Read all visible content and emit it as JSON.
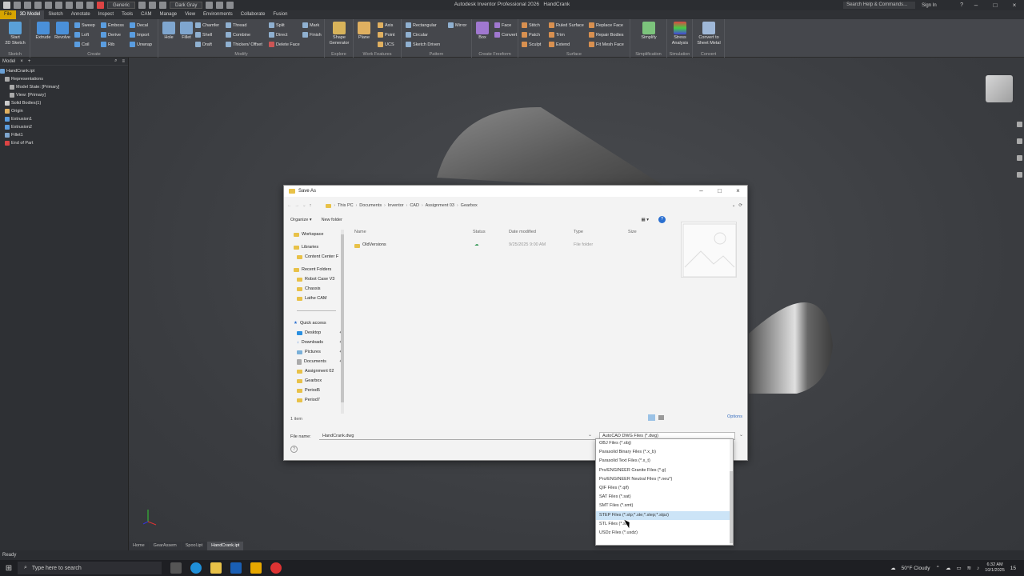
{
  "titlebar": {
    "app_title": "Autodesk Inventor Professional 2026",
    "doc_title": "HandCrank",
    "appearance": "Generic",
    "theme": "Dark Gray",
    "help_search_placeholder": "Search Help & Commands...",
    "signin": "Sign In"
  },
  "tabs": [
    "File",
    "3D Model",
    "Sketch",
    "Annotate",
    "Inspect",
    "Tools",
    "CAM",
    "Manage",
    "View",
    "Environments",
    "Collaborate",
    "Fusion"
  ],
  "ribbon": {
    "sketch": {
      "title": "Sketch",
      "start": "Start\n2D Sketch"
    },
    "create": {
      "title": "Create",
      "items": [
        "Extrude",
        "Revolve",
        "Sweep",
        "Loft",
        "Coil",
        "Emboss",
        "Derive",
        "Rib",
        "Decal",
        "Import",
        "Unwrap"
      ]
    },
    "modify": {
      "title": "Modify",
      "items": [
        "Hole",
        "Fillet",
        "Chamfer",
        "Shell",
        "Draft",
        "Thread",
        "Combine",
        "Thicken/ Offset",
        "Split",
        "Direct",
        "Delete Face"
      ]
    },
    "explore": {
      "title": "Explore",
      "item": "Shape\nGenerator"
    },
    "work": {
      "title": "Work Features",
      "plane": "Plane",
      "items": [
        "Axis",
        "Point",
        "UCS"
      ]
    },
    "pattern": {
      "title": "Pattern",
      "items": [
        "Rectangular",
        "Circular",
        "Sketch Driven",
        "Mirror"
      ]
    },
    "freeform": {
      "title": "Create Freeform",
      "box": "Box",
      "items": [
        "Face",
        "Convert"
      ]
    },
    "surface": {
      "title": "Surface",
      "items": [
        "Stitch",
        "Patch",
        "Sculpt",
        "Ruled Surface",
        "Trim",
        "Extend",
        "Replace Face",
        "Repair Bodies",
        "Fit Mesh Face"
      ]
    },
    "mark": {
      "items": [
        "Mark",
        "Finish"
      ]
    },
    "simplification": {
      "title": "Simplification",
      "item": "Simplify"
    },
    "simulation": {
      "title": "Simulation",
      "item": "Stress\nAnalysis"
    },
    "convert": {
      "title": "Convert",
      "item": "Convert to\nSheet Metal"
    }
  },
  "browser": {
    "title": "Model",
    "items": [
      "HandCrank.ipt",
      "Representations",
      "Model State: [Primary]",
      "View: [Primary]",
      "Solid Bodies(1)",
      "Origin",
      "Extrusion1",
      "Extrusion2",
      "Fillet1",
      "End of Part"
    ]
  },
  "doc_tabs": [
    "Home",
    "GearAssem",
    "Spool.ipt",
    "HandCrank.ipt"
  ],
  "status": "Ready",
  "dialog": {
    "title": "Save As",
    "breadcrumbs": [
      "This PC",
      "Documents",
      "Inventor",
      "CAD",
      "Assignment 03",
      "Gearbox"
    ],
    "organize": "Organize",
    "new_folder": "New folder",
    "nav": {
      "workspace": "Workspace",
      "libraries": "Libraries",
      "content_center": "Content Center F",
      "recent": "Recent Folders",
      "recent_items": [
        "Robot Case V3",
        "Chassis",
        "Lathe CAM"
      ],
      "quick_access": "Quick access",
      "quick_items": [
        "Desktop",
        "Downloads",
        "Pictures",
        "Documents",
        "Assignment 02",
        "Gearbox",
        "Period5",
        "Period7"
      ]
    },
    "columns": {
      "name": "Name",
      "status": "Status",
      "date": "Date modified",
      "type": "Type",
      "size": "Size"
    },
    "rows": [
      {
        "name": "OldVersions",
        "date": "9/25/2025 9:00 AM",
        "type": "File folder"
      }
    ],
    "count": "1 item",
    "options": "Options",
    "file_name_label": "File name:",
    "file_name": "HandCrank.dwg",
    "file_type": "AutoCAD DWG Files (*.dwg)"
  },
  "dropdown": [
    "OBJ Files (*.obj)",
    "Parasolid Binary Files (*.x_b)",
    "Parasolid Text Files (*.x_t)",
    "Pro/ENGINEER Granite Files (*.g)",
    "Pro/ENGINEER Neutral Files (*.neu*)",
    "QIF Files (*.qif)",
    "SAT Files (*.sat)",
    "SMT Files (*.smt)",
    "STEP Files (*.stp;*.ste;*.step;*.stpz)",
    "STL Files (*.stl)",
    "USDz Files (*.usdz)"
  ],
  "taskbar": {
    "search_placeholder": "Type here to search",
    "weather": "50°F  Cloudy",
    "time": "6:32 AM",
    "date": "10/1/2025",
    "badge": "15"
  }
}
